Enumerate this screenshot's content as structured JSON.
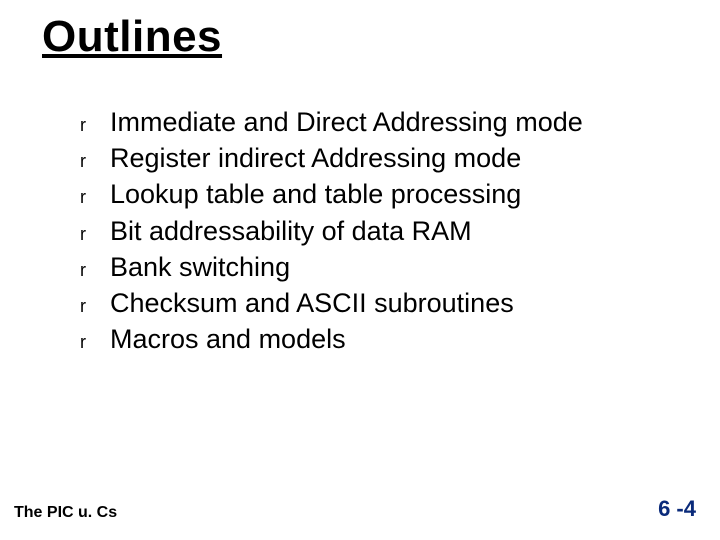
{
  "title": "Outlines",
  "bullet_char": "r",
  "items": [
    "Immediate and Direct Addressing mode",
    "Register indirect Addressing mode",
    "Lookup table and table processing",
    "Bit addressability of data RAM",
    "Bank switching",
    "Checksum and ASCII subroutines",
    "Macros and models"
  ],
  "footer_left": "The PIC u. Cs",
  "footer_right": "6 -4"
}
